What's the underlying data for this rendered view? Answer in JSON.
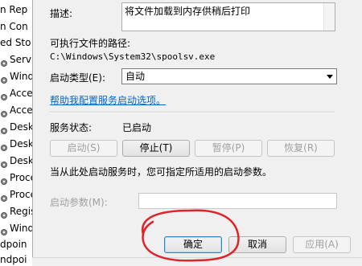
{
  "background_list": {
    "rows": [
      "n Rep",
      "n Con",
      "ed Sto",
      "Servi",
      "Windo",
      "Acce",
      "Acce",
      "Desk",
      "Desk",
      "Desk",
      "Proce",
      "Proce",
      "Regis",
      "Windo",
      "dpoin",
      "ndpoi"
    ]
  },
  "dialog": {
    "description_label": "描述:",
    "description_value": "将文件加载到内存供稍后打印",
    "exe_path_label": "可执行文件的路径:",
    "exe_path_value": "C:\\Windows\\System32\\spoolsv.exe",
    "startup_type_label": "启动类型(E):",
    "startup_type_value": "自动",
    "help_link": "帮助我配置服务启动选项。",
    "service_status_label": "服务状态:",
    "service_status_value": "已启动",
    "start_button": "启动(S)",
    "stop_button": "停止(T)",
    "pause_button": "暂停(P)",
    "resume_button": "恢复(R)",
    "start_params_note": "当从此处启动服务时，您可指定所适用的启动参数。",
    "start_params_label": "启动参数(M):",
    "start_params_value": "",
    "ok_button": "确定",
    "cancel_button": "取消",
    "apply_button": "应用(A)"
  },
  "colors": {
    "dialog_bg": "#f0f0f0",
    "link": "#0066cc",
    "annotation": "#e0232a"
  }
}
